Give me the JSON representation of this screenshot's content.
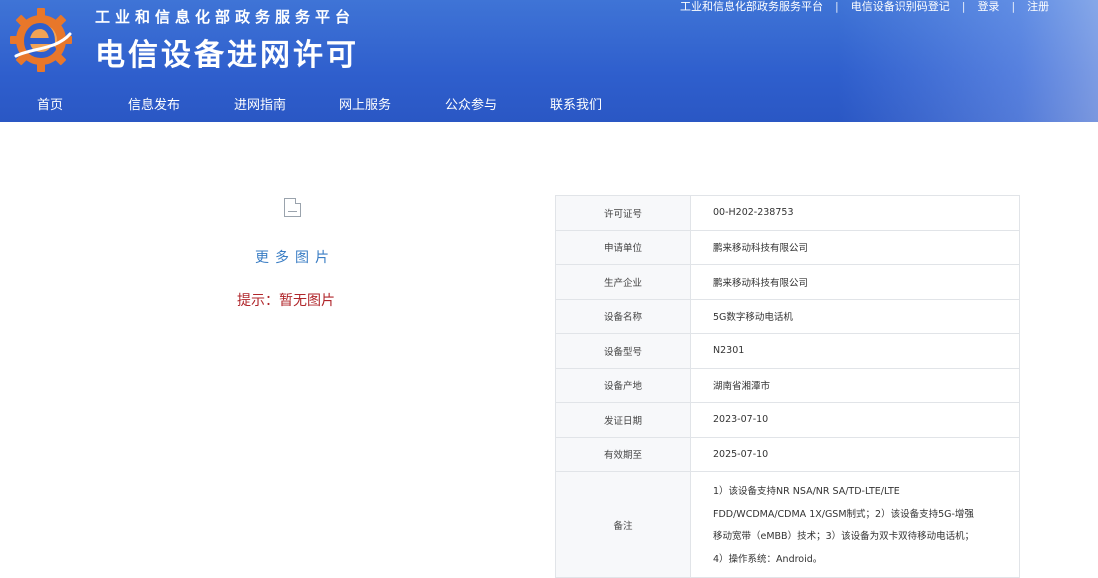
{
  "header": {
    "platform_name": "工业和信息化部政务服务平台",
    "site_title": "电信设备进网许可",
    "logo_icon": "gear-e-logo-icon",
    "top_links": [
      "工业和信息化部政务服务平台",
      "电信设备识别码登记",
      "登录",
      "注册"
    ],
    "nav": [
      "首页",
      "信息发布",
      "进网指南",
      "网上服务",
      "公众参与",
      "联系我们"
    ],
    "colors": {
      "bar": "#2f5fcd",
      "logo": "#e8772a"
    }
  },
  "image_panel": {
    "placeholder_icon": "broken-image-icon",
    "more_images": "更多图片",
    "hint": "提示：暂无图片"
  },
  "details": {
    "rows": [
      {
        "label": "许可证号",
        "value": "00-H202-238753"
      },
      {
        "label": "申请单位",
        "value": "鹏来移动科技有限公司"
      },
      {
        "label": "生产企业",
        "value": "鹏来移动科技有限公司"
      },
      {
        "label": "设备名称",
        "value": "5G数字移动电话机"
      },
      {
        "label": "设备型号",
        "value": "N2301"
      },
      {
        "label": "设备产地",
        "value": "湖南省湘潭市"
      },
      {
        "label": "发证日期",
        "value": "2023-07-10"
      },
      {
        "label": "有效期至",
        "value": "2025-07-10"
      }
    ],
    "note_label": "备注",
    "note_lines": [
      "1）该设备支持NR NSA/NR SA/TD-LTE/LTE",
      "FDD/WCDMA/CDMA 1X/GSM制式；2）该设备支持5G-增强",
      "移动宽带（eMBB）技术；3）该设备为双卡双待移动电话机；",
      "4）操作系统：Android。"
    ]
  }
}
